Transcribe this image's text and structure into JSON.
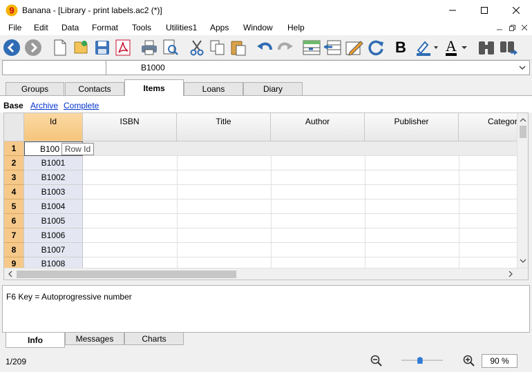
{
  "window": {
    "app_name": "Banana",
    "title": "Banana - [Library - print labels.ac2 (*)]",
    "icons": {
      "minimize": "minimize-icon",
      "maximize": "maximize-icon",
      "close": "close-icon"
    }
  },
  "menu": {
    "items": [
      "File",
      "Edit",
      "Data",
      "Format",
      "Tools",
      "Utilities1",
      "Apps",
      "Window",
      "Help"
    ]
  },
  "toolbar": {
    "buttons": [
      "back-icon",
      "forward-icon",
      "new-icon",
      "open-icon",
      "save-icon",
      "pdf-icon",
      "print-icon",
      "print-preview-icon",
      "cut-icon",
      "copy-icon",
      "paste-icon",
      "undo-icon",
      "redo-icon",
      "add-row-icon",
      "delete-row-icon",
      "edit-icon",
      "recalculate-icon",
      "bold-icon",
      "highlight-icon",
      "font-color-icon",
      "find-icon",
      "find-next-icon"
    ],
    "bold_label": "B",
    "font_color_label": "A"
  },
  "cellbar": {
    "value": "B1000"
  },
  "tables": {
    "tabs": [
      "Groups",
      "Contacts",
      "Items",
      "Loans",
      "Diary"
    ],
    "active": "Items"
  },
  "views": {
    "base": "Base",
    "links": [
      "Archive",
      "Complete"
    ]
  },
  "grid": {
    "columns": [
      "Id",
      "ISBN",
      "Title",
      "Author",
      "Publisher",
      "Categor"
    ],
    "rows": [
      {
        "num": "1",
        "id": "B1000"
      },
      {
        "num": "2",
        "id": "B1001"
      },
      {
        "num": "3",
        "id": "B1002"
      },
      {
        "num": "4",
        "id": "B1003"
      },
      {
        "num": "5",
        "id": "B1004"
      },
      {
        "num": "6",
        "id": "B1005"
      },
      {
        "num": "7",
        "id": "B1006"
      },
      {
        "num": "8",
        "id": "B1007"
      },
      {
        "num": "9",
        "id": "B1008"
      }
    ],
    "first_row_visible": "B100",
    "tooltip": "Row Id"
  },
  "info": {
    "text": "F6 Key = Autoprogressive number"
  },
  "bottom_tabs": {
    "tabs": [
      "Info",
      "Messages",
      "Charts"
    ],
    "active": "Info"
  },
  "status": {
    "position": "1/209",
    "zoom": "90 %"
  },
  "colors": {
    "accent_orange": "#f6c98a",
    "id_column": "#e4e7f2",
    "link_blue": "#0033cc"
  }
}
